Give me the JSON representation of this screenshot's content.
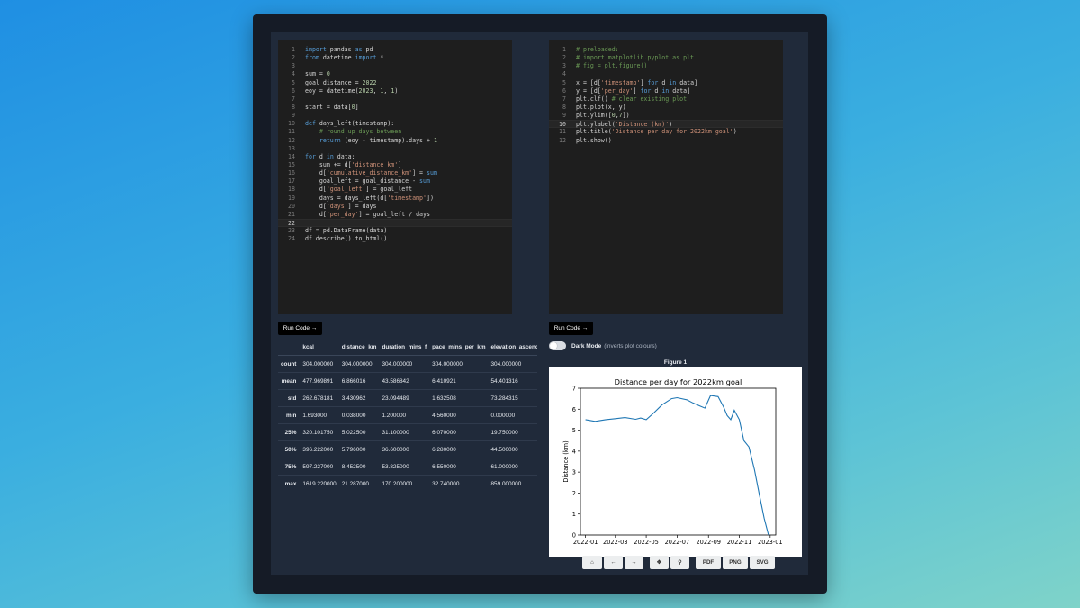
{
  "left_editor": {
    "lines": [
      [
        {
          "t": "import",
          "c": "kw"
        },
        {
          "t": " pandas ",
          "c": "p"
        },
        {
          "t": "as",
          "c": "kw"
        },
        {
          "t": " pd",
          "c": "p"
        }
      ],
      [
        {
          "t": "from",
          "c": "kw"
        },
        {
          "t": " datetime ",
          "c": "p"
        },
        {
          "t": "import",
          "c": "kw"
        },
        {
          "t": " *",
          "c": "p"
        }
      ],
      [],
      [
        {
          "t": "sum = ",
          "c": "p"
        },
        {
          "t": "0",
          "c": "num"
        }
      ],
      [
        {
          "t": "goal_distance = ",
          "c": "p"
        },
        {
          "t": "2022",
          "c": "num"
        }
      ],
      [
        {
          "t": "eoy = datetime(",
          "c": "p"
        },
        {
          "t": "2023",
          "c": "num"
        },
        {
          "t": ", ",
          "c": "p"
        },
        {
          "t": "1",
          "c": "num"
        },
        {
          "t": ", ",
          "c": "p"
        },
        {
          "t": "1",
          "c": "num"
        },
        {
          "t": ")",
          "c": "p"
        }
      ],
      [],
      [
        {
          "t": "start = data[",
          "c": "p"
        },
        {
          "t": "0",
          "c": "num"
        },
        {
          "t": "]",
          "c": "p"
        }
      ],
      [],
      [
        {
          "t": "def",
          "c": "kw"
        },
        {
          "t": " days_left(timestamp):",
          "c": "p"
        }
      ],
      [
        {
          "t": "    # round up days between",
          "c": "cm"
        }
      ],
      [
        {
          "t": "    ",
          "c": "p"
        },
        {
          "t": "return",
          "c": "kw"
        },
        {
          "t": " (eoy - timestamp).days + ",
          "c": "p"
        },
        {
          "t": "1",
          "c": "num"
        }
      ],
      [],
      [
        {
          "t": "for",
          "c": "kw"
        },
        {
          "t": " d ",
          "c": "p"
        },
        {
          "t": "in",
          "c": "kw"
        },
        {
          "t": " data:",
          "c": "p"
        }
      ],
      [
        {
          "t": "    sum += d[",
          "c": "p"
        },
        {
          "t": "'distance_km'",
          "c": "str"
        },
        {
          "t": "]",
          "c": "p"
        }
      ],
      [
        {
          "t": "    d[",
          "c": "p"
        },
        {
          "t": "'cumulative_distance_km'",
          "c": "str"
        },
        {
          "t": "] = ",
          "c": "p"
        },
        {
          "t": "sum",
          "c": "kw"
        }
      ],
      [
        {
          "t": "    goal_left = goal_distance - ",
          "c": "p"
        },
        {
          "t": "sum",
          "c": "kw"
        }
      ],
      [
        {
          "t": "    d[",
          "c": "p"
        },
        {
          "t": "'goal_left'",
          "c": "str"
        },
        {
          "t": "] = goal_left",
          "c": "p"
        }
      ],
      [
        {
          "t": "    days = days_left(d[",
          "c": "p"
        },
        {
          "t": "'timestamp'",
          "c": "str"
        },
        {
          "t": "])",
          "c": "p"
        }
      ],
      [
        {
          "t": "    d[",
          "c": "p"
        },
        {
          "t": "'days'",
          "c": "str"
        },
        {
          "t": "] = days",
          "c": "p"
        }
      ],
      [
        {
          "t": "    d[",
          "c": "p"
        },
        {
          "t": "'per_day'",
          "c": "str"
        },
        {
          "t": "] = goal_left / days",
          "c": "p"
        }
      ],
      [],
      [
        {
          "t": "df = pd.DataFrame(data)",
          "c": "p"
        }
      ],
      [
        {
          "t": "df.describe().to_html()",
          "c": "p"
        }
      ]
    ],
    "active_line": 22
  },
  "right_editor": {
    "lines": [
      [
        {
          "t": "# preloaded:",
          "c": "cm"
        }
      ],
      [
        {
          "t": "# import matplotlib.pyplot as plt",
          "c": "cm"
        }
      ],
      [
        {
          "t": "# fig = plt.figure()",
          "c": "cm"
        }
      ],
      [],
      [
        {
          "t": "x = [d[",
          "c": "p"
        },
        {
          "t": "'timestamp'",
          "c": "str"
        },
        {
          "t": "] ",
          "c": "p"
        },
        {
          "t": "for",
          "c": "kw"
        },
        {
          "t": " d ",
          "c": "p"
        },
        {
          "t": "in",
          "c": "kw"
        },
        {
          "t": " data]",
          "c": "p"
        }
      ],
      [
        {
          "t": "y = [d[",
          "c": "p"
        },
        {
          "t": "'per_day'",
          "c": "str"
        },
        {
          "t": "] ",
          "c": "p"
        },
        {
          "t": "for",
          "c": "kw"
        },
        {
          "t": " d ",
          "c": "p"
        },
        {
          "t": "in",
          "c": "kw"
        },
        {
          "t": " data]",
          "c": "p"
        }
      ],
      [
        {
          "t": "plt.clf() ",
          "c": "p"
        },
        {
          "t": "# clear existing plot",
          "c": "cm"
        }
      ],
      [
        {
          "t": "plt.plot(x, y)",
          "c": "p"
        }
      ],
      [
        {
          "t": "plt.ylim([",
          "c": "p"
        },
        {
          "t": "0",
          "c": "num"
        },
        {
          "t": ",",
          "c": "p"
        },
        {
          "t": "7",
          "c": "num"
        },
        {
          "t": "])",
          "c": "p"
        }
      ],
      [
        {
          "t": "plt.ylabel(",
          "c": "p"
        },
        {
          "t": "'Distance (km)'",
          "c": "str"
        },
        {
          "t": ")",
          "c": "p"
        }
      ],
      [
        {
          "t": "plt.title(",
          "c": "p"
        },
        {
          "t": "'Distance per day for 2022km goal'",
          "c": "str"
        },
        {
          "t": ")",
          "c": "p"
        }
      ],
      [
        {
          "t": "plt.show()",
          "c": "p"
        }
      ]
    ],
    "active_line": 10
  },
  "run_button_label": "Run Code →",
  "stats_table": {
    "columns": [
      "kcal",
      "distance_km",
      "duration_mins_f",
      "pace_mins_per_km",
      "elevation_ascende"
    ],
    "rows": [
      {
        "label": "count",
        "values": [
          "304.000000",
          "304.000000",
          "304.000000",
          "304.000000",
          "304.000000"
        ]
      },
      {
        "label": "mean",
        "values": [
          "477.969891",
          "6.866016",
          "43.586842",
          "6.410921",
          "54.401316"
        ]
      },
      {
        "label": "std",
        "values": [
          "262.678181",
          "3.430962",
          "23.094489",
          "1.632508",
          "73.284315"
        ]
      },
      {
        "label": "min",
        "values": [
          "1.693000",
          "0.038000",
          "1.200000",
          "4.560000",
          "0.000000"
        ]
      },
      {
        "label": "25%",
        "values": [
          "320.101750",
          "5.022500",
          "31.100000",
          "6.070000",
          "19.750000"
        ]
      },
      {
        "label": "50%",
        "values": [
          "396.222000",
          "5.796000",
          "36.600000",
          "6.280000",
          "44.500000"
        ]
      },
      {
        "label": "75%",
        "values": [
          "597.227000",
          "8.452500",
          "53.825000",
          "6.550000",
          "61.000000"
        ]
      },
      {
        "label": "max",
        "values": [
          "1619.220000",
          "21.287000",
          "170.200000",
          "32.740000",
          "859.000000"
        ]
      }
    ]
  },
  "dark_mode": {
    "label": "Dark Mode",
    "hint": "(inverts plot colours)",
    "enabled": false
  },
  "figure_title": "Figure 1",
  "toolbar": {
    "pdf_label": "PDF",
    "png_label": "PNG",
    "svg_label": "SVG",
    "home_icon": "⌂",
    "back_icon": "←",
    "forward_icon": "→",
    "pan_icon": "✥",
    "zoom_icon": "⚲"
  },
  "colors": {
    "kw": "#569cd6",
    "str": "#ce9178",
    "num": "#b5cea8",
    "cm": "#6a9955",
    "p": "#d4d4d4"
  },
  "chart_data": {
    "type": "line",
    "title": "Distance per day for 2022km goal",
    "ylabel": "Distance (km)",
    "xlabel": "",
    "ylim": [
      0,
      7
    ],
    "yticks": [
      "0",
      "1",
      "2",
      "3",
      "4",
      "5",
      "6",
      "7"
    ],
    "xticks": [
      "2022-01",
      "2022-03",
      "2022-05",
      "2022-07",
      "2022-09",
      "2022-11",
      "2023-01"
    ],
    "xlim": [
      "2021-12-22",
      "2023-01-12"
    ],
    "series": [
      {
        "x": [
          "2022-01-01",
          "2022-01-20",
          "2022-02-10",
          "2022-03-01",
          "2022-03-20",
          "2022-04-10",
          "2022-04-20",
          "2022-05-01",
          "2022-05-15",
          "2022-06-01",
          "2022-06-20",
          "2022-07-01",
          "2022-07-20",
          "2022-08-01",
          "2022-08-15",
          "2022-08-25",
          "2022-09-05",
          "2022-09-20",
          "2022-10-01",
          "2022-10-08",
          "2022-10-15",
          "2022-10-22",
          "2022-11-01",
          "2022-11-10",
          "2022-11-20",
          "2022-12-01",
          "2022-12-10",
          "2022-12-20",
          "2022-12-28",
          "2022-12-31"
        ],
        "y": [
          5.5,
          5.42,
          5.5,
          5.55,
          5.6,
          5.52,
          5.58,
          5.5,
          5.8,
          6.2,
          6.5,
          6.55,
          6.45,
          6.3,
          6.15,
          6.05,
          6.65,
          6.6,
          6.1,
          5.7,
          5.5,
          5.95,
          5.5,
          4.5,
          4.2,
          3.1,
          2.0,
          0.8,
          0.05,
          0.0
        ]
      }
    ]
  }
}
